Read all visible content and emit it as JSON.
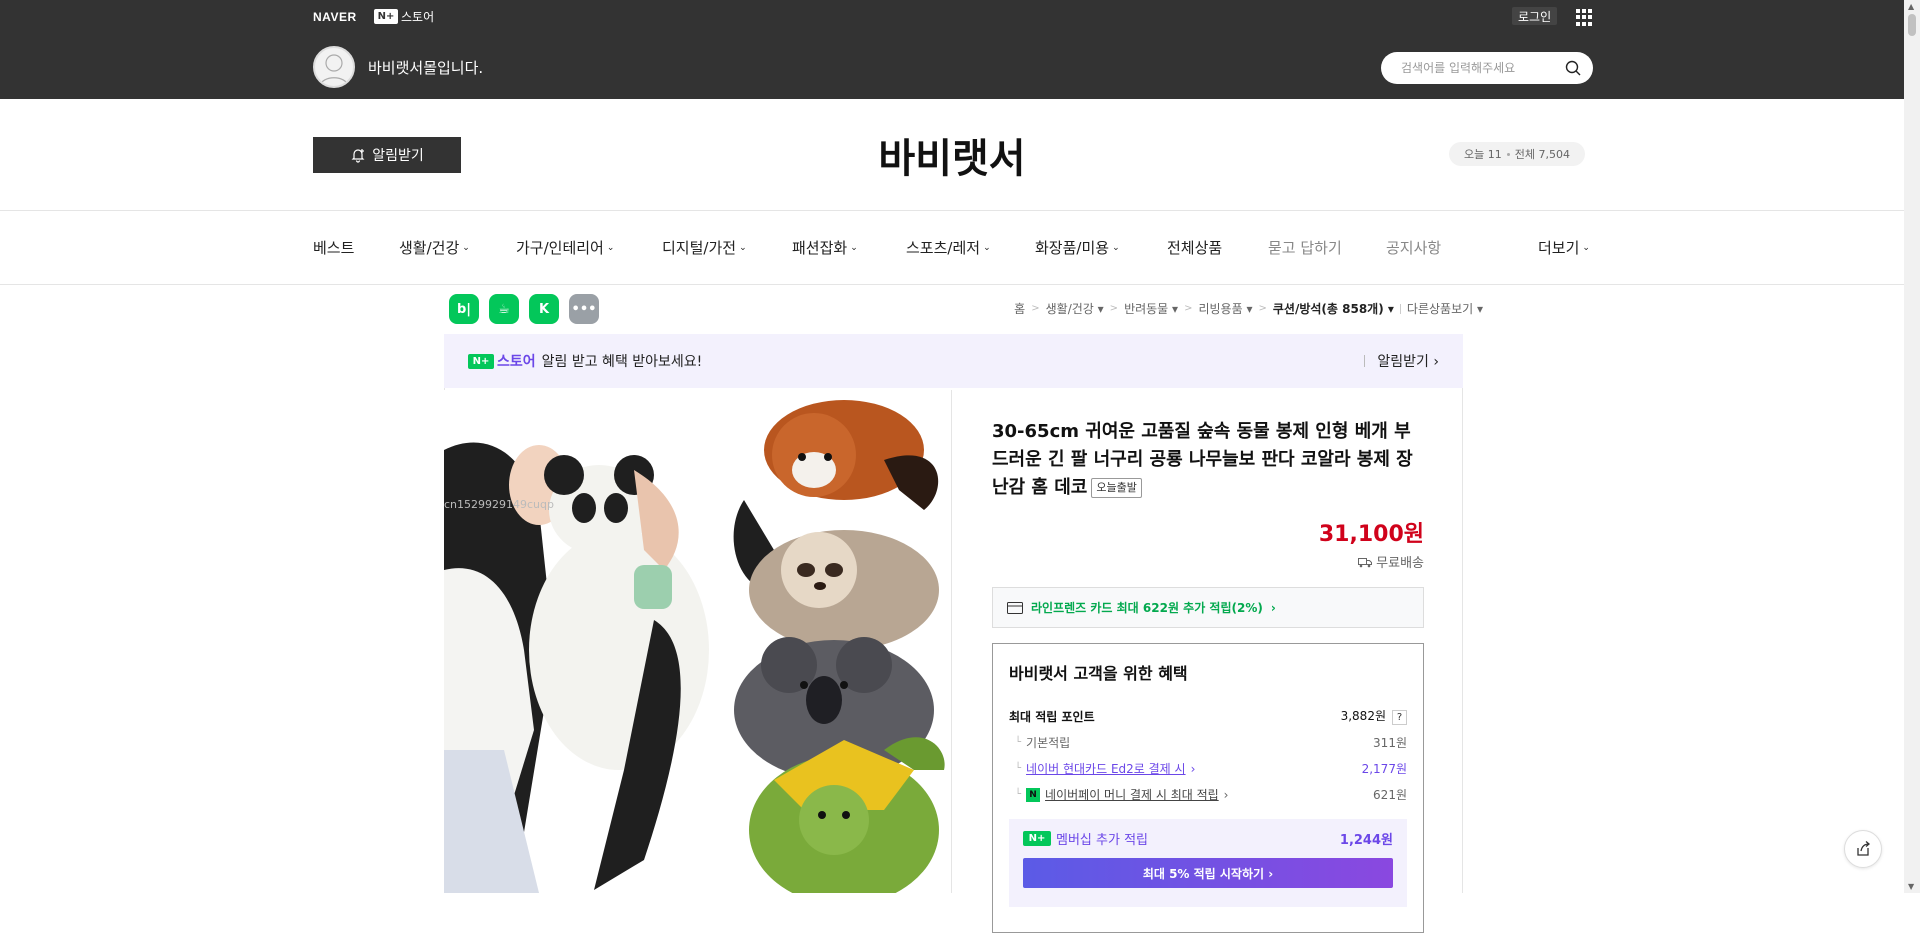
{
  "topbar": {
    "naver_logo": "NAVER",
    "nplus_badge": "N+",
    "store_label": "스토어",
    "login": "로그인",
    "greeting": "바비랫서몰입니다.",
    "search_placeholder": "검색어를 입력해주세요"
  },
  "header": {
    "alarm_button": "알림받기",
    "store_name": "바비랫서",
    "visitors_today": "오늘 11",
    "visitors_total": "전체 7,504"
  },
  "nav": {
    "items": [
      {
        "label": "베스트"
      },
      {
        "label": "생활/건강"
      },
      {
        "label": "가구/인테리어"
      },
      {
        "label": "디지털/가전"
      },
      {
        "label": "패션잡화"
      },
      {
        "label": "스포츠/레저"
      },
      {
        "label": "화장품/미용"
      },
      {
        "label": "전체상품"
      },
      {
        "label": "묻고 답하기"
      },
      {
        "label": "공지사항"
      },
      {
        "label": "더보기"
      }
    ]
  },
  "share": {
    "blog": "b|",
    "cafe": "☕",
    "keep": "K",
    "more": "•••"
  },
  "breadcrumb": {
    "home": "홈",
    "c1": "생활/건강",
    "c2": "반려동물",
    "c3": "리빙용품",
    "c4": "쿠션/방석(총 858개)",
    "other": "다른상품보기"
  },
  "promo": {
    "nplus": "N+",
    "store": "스토어",
    "text": "알림 받고 혜택 받아보세요!",
    "action": "알림받기"
  },
  "product": {
    "title": "30-65cm 귀여운 고품질 숲속 동물 봉제 인형 베개 부드러운 긴 팔 너구리 공룡 나무늘보 판다 코알라 봉제 장난감 홈 데코",
    "badge": "오늘출발",
    "price": "31,100원",
    "shipping": "무료배송",
    "card_benefit": "라인프렌즈 카드 최대 622원 추가 적립(2%)",
    "image_watermark": "cn1529929149cuqp"
  },
  "benefits": {
    "title": "바비랫서 고객을 위한 혜택",
    "max_points_label": "최대 적립 포인트",
    "max_points_value": "3,882원",
    "help": "?",
    "rows": [
      {
        "label": "기본적립",
        "value": "311원"
      },
      {
        "label": "네이버 현대카드 Ed2로 결제 시",
        "value": "2,177원"
      },
      {
        "label": "네이버페이 머니 결제 시 최대 적립",
        "value": "621원",
        "badge": "N"
      }
    ],
    "membership_label": "멤버십 추가 적립",
    "membership_value": "1,244원",
    "cta": "최대 5% 적립 시작하기"
  },
  "colors": {
    "topbar": "#333333",
    "price_red": "#d0021b",
    "naver_green": "#03c75a",
    "purple": "#6b47e8"
  }
}
